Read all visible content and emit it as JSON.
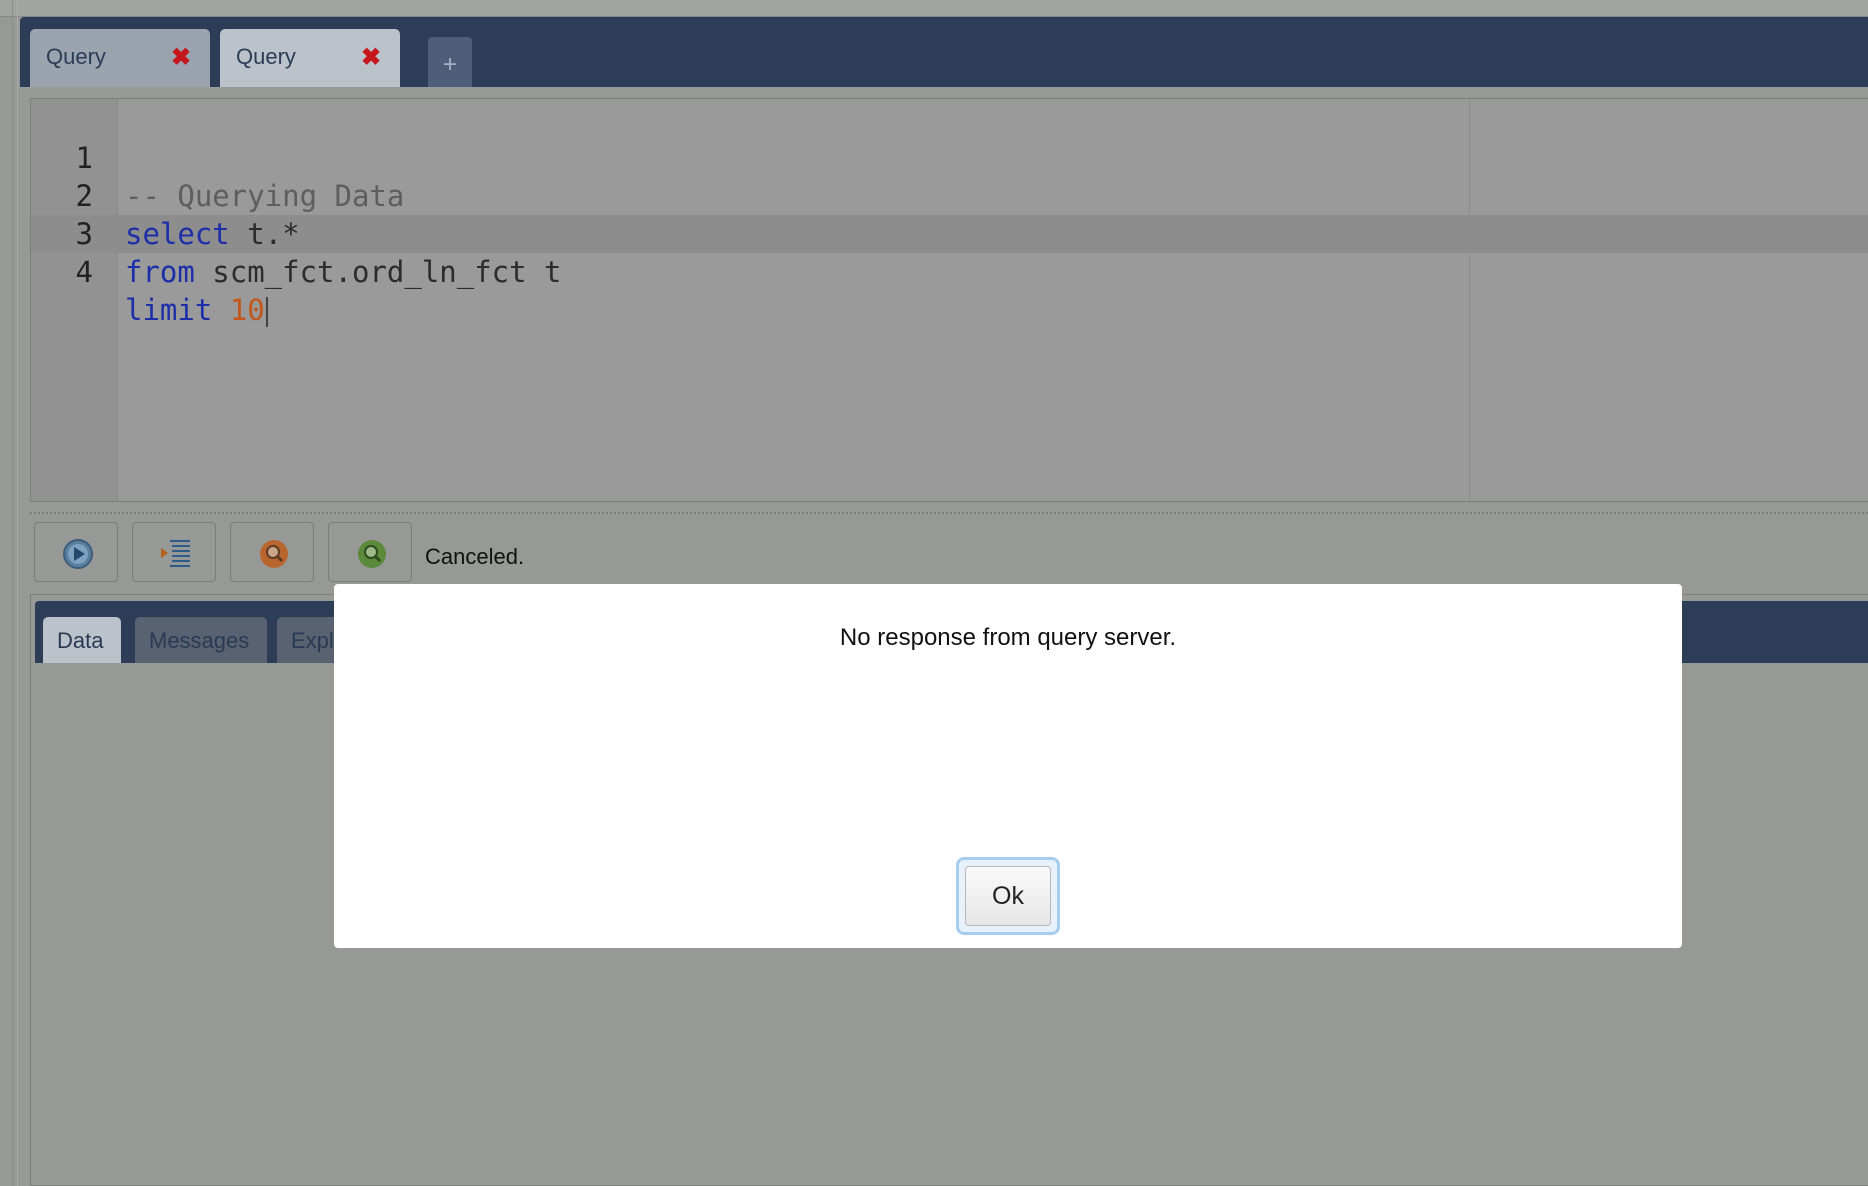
{
  "query_tabs": [
    {
      "label": "Query",
      "active": false
    },
    {
      "label": "Query",
      "active": true
    }
  ],
  "add_tab_label": "+",
  "editor": {
    "lines": [
      {
        "num": "1",
        "comment": "-- Querying Data"
      },
      {
        "num": "2",
        "kw": "select",
        "rest": " t.*"
      },
      {
        "num": "3",
        "kw": "from",
        "rest": " scm_fct.ord_ln_fct t"
      },
      {
        "num": "4",
        "kw": "limit",
        "rest": " ",
        "number": "10"
      }
    ],
    "active_line": 4
  },
  "toolbar": {
    "buttons": [
      {
        "name": "run",
        "icon": "play-icon"
      },
      {
        "name": "format",
        "icon": "indent-icon"
      },
      {
        "name": "explain",
        "icon": "search-orange-icon"
      },
      {
        "name": "explain-analyze",
        "icon": "search-green-icon"
      }
    ],
    "status": "Canceled."
  },
  "results_tabs": [
    {
      "label": "Data",
      "active": true
    },
    {
      "label": "Messages",
      "active": false
    },
    {
      "label": "Expl",
      "active": false
    }
  ],
  "dialog": {
    "message": "No response from query server.",
    "ok_label": "Ok"
  },
  "colors": {
    "tabbar": "#2d3d58",
    "keyword": "#1c2fa8",
    "number": "#c3561a",
    "close": "#c4161c"
  }
}
